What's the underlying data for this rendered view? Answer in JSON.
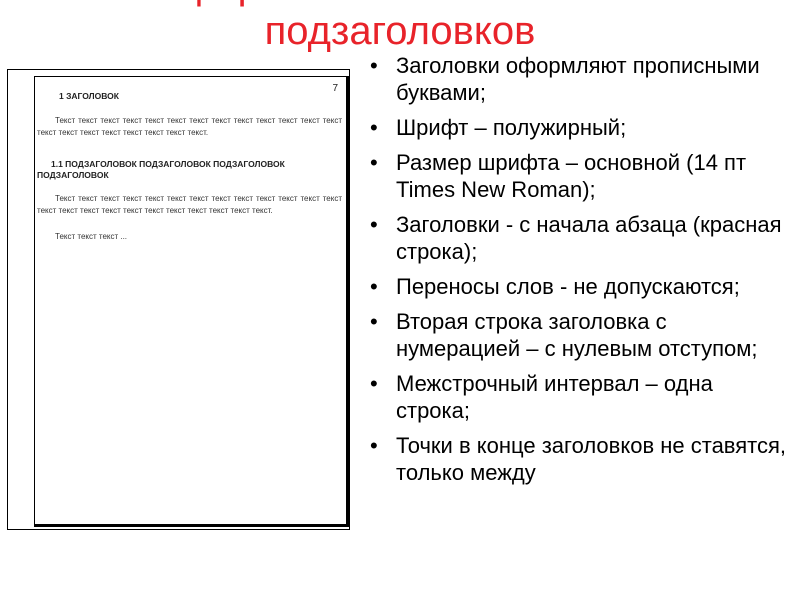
{
  "slide": {
    "title_line1": "Оформление заголовков и",
    "title_line2": "подзаголовков"
  },
  "document_sample": {
    "page_number": "7",
    "heading1": "1 ЗАГОЛОВОК",
    "paragraph1": "Текст текст текст текст текст текст текст текст текст текст текст текст текст текст текст текст текст текст текст текст текст.",
    "heading2": "1.1 ПОДЗАГОЛОВОК  ПОДЗАГОЛОВОК ПОДЗАГОЛОВОК ПОДЗАГОЛОВОК",
    "paragraph2": "Текст текст текст текст текст текст текст текст текст текст текст  текст  текст  текст  текст  текст  текст текст текст текст текст текст текст текст.",
    "paragraph3": "Текст текст текст ..."
  },
  "bullets": [
    "Заголовки оформляют прописными буквами;",
    "Шрифт – полужирный;",
    "Размер шрифта – основной (14 пт Times New Roman);",
    "Заголовки -  с начала абзаца (красная строка);",
    "Переносы слов - не допускаются;",
    "Вторая строка заголовка с нумерацией – с нулевым отступом;",
    "Межстрочный интервал – одна строка;",
    "Точки в конце заголовков не ставятся, только между"
  ],
  "bullet_symbol": "•",
  "colors": {
    "title": "#e8232a",
    "text": "#000000"
  }
}
